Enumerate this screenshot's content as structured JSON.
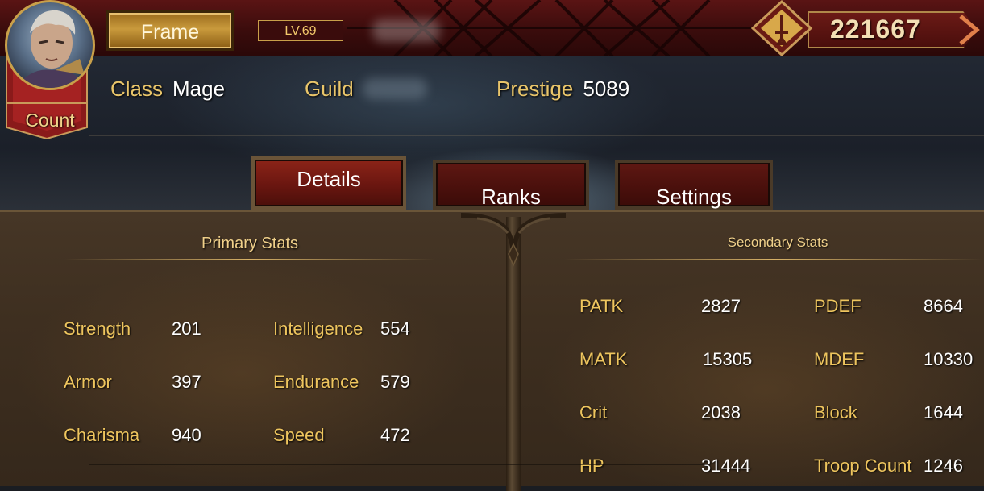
{
  "profile": {
    "frame_label": "Frame",
    "level": "LV.69",
    "rank_title": "Count",
    "currency_value": "221667",
    "class_label": "Class",
    "class_value": "Mage",
    "guild_label": "Guild",
    "prestige_label": "Prestige",
    "prestige_value": "5089"
  },
  "tabs": [
    {
      "label": "Details",
      "active": true
    },
    {
      "label": "Ranks",
      "active": false
    },
    {
      "label": "Settings",
      "active": false
    }
  ],
  "primary_stats": {
    "title": "Primary Stats",
    "items": [
      {
        "label": "Strength",
        "value": "201"
      },
      {
        "label": "Intelligence",
        "value": "554"
      },
      {
        "label": "Armor",
        "value": "397"
      },
      {
        "label": "Endurance",
        "value": "579"
      },
      {
        "label": "Charisma",
        "value": "940"
      },
      {
        "label": "Speed",
        "value": "472"
      }
    ]
  },
  "secondary_stats": {
    "title": "Secondary Stats",
    "items": [
      {
        "label": "PATK",
        "value": "2827"
      },
      {
        "label": "PDEF",
        "value": "8664"
      },
      {
        "label": "MATK",
        "value": "15305"
      },
      {
        "label": "MDEF",
        "value": "10330"
      },
      {
        "label": "Crit",
        "value": "2038"
      },
      {
        "label": "Block",
        "value": "1644"
      },
      {
        "label": "HP",
        "value": "31444"
      },
      {
        "label": "Troop Count",
        "value": "1246"
      }
    ]
  },
  "icons": {
    "currency": "sword-emblem-icon",
    "currency_arrow": "chevron-right-icon",
    "avatar": "hero-portrait"
  },
  "colors": {
    "accent_gold": "#eec55e",
    "title_gold": "#f0d08a",
    "header_red": "#5a1414",
    "tab_active": "#8c2418",
    "value_white": "#ffffff"
  }
}
